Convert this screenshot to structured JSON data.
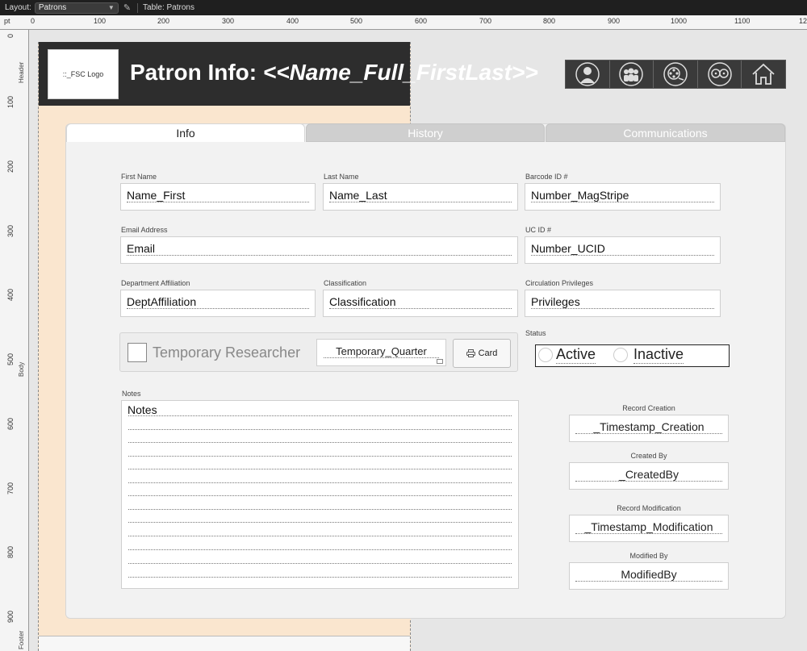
{
  "toolbar": {
    "layout_label": "Layout:",
    "layout_value": "Patrons",
    "table_label": "Table: Patrons"
  },
  "ruler": {
    "unit": "pt",
    "h_ticks": [
      "0",
      "100",
      "200",
      "300",
      "400",
      "500",
      "600",
      "700",
      "800",
      "900",
      "1000",
      "1100",
      "12"
    ],
    "v_ticks": [
      "0",
      "100",
      "200",
      "300",
      "400",
      "500",
      "600",
      "700",
      "800",
      "900"
    ],
    "parts": [
      "Header",
      "Body",
      "Footer"
    ]
  },
  "header": {
    "logo_text": "::_FSC Logo",
    "title_prefix": "Patron Info: ",
    "title_dynamic": "<<Name_Full_FirstLast>>",
    "nav_icons": [
      "person-icon",
      "group-icon",
      "film-reel-icon",
      "film-reels-icon",
      "home-icon"
    ]
  },
  "tabs": [
    "Info",
    "History",
    "Communications"
  ],
  "fields": {
    "first_name": {
      "label": "First Name",
      "value": "Name_First"
    },
    "last_name": {
      "label": "Last Name",
      "value": "Name_Last"
    },
    "barcode": {
      "label": "Barcode ID #",
      "value": "Number_MagStripe"
    },
    "email": {
      "label": "Email Address",
      "value": "Email"
    },
    "ucid": {
      "label": "UC ID #",
      "value": "Number_UCID"
    },
    "dept": {
      "label": "Department Affiliation",
      "value": "DeptAffiliation"
    },
    "classification": {
      "label": "Classification",
      "value": "Classification"
    },
    "privileges": {
      "label": "Circulation Privileges",
      "value": "Privileges"
    }
  },
  "temp": {
    "label": "Temporary Researcher",
    "quarter": "Temporary_Quarter",
    "card_button": "Card"
  },
  "status": {
    "label": "Status",
    "options": [
      "Active",
      "Inactive"
    ]
  },
  "notes": {
    "label": "Notes",
    "value": "Notes"
  },
  "meta": {
    "record_creation": {
      "label": "Record Creation",
      "value": "_Timestamp_Creation"
    },
    "created_by": {
      "label": "Created By",
      "value": "_CreatedBy"
    },
    "record_modification": {
      "label": "Record Modification",
      "value": "_Timestamp_Modification"
    },
    "modified_by": {
      "label": "Modified By",
      "value": "ModifiedBy"
    }
  }
}
